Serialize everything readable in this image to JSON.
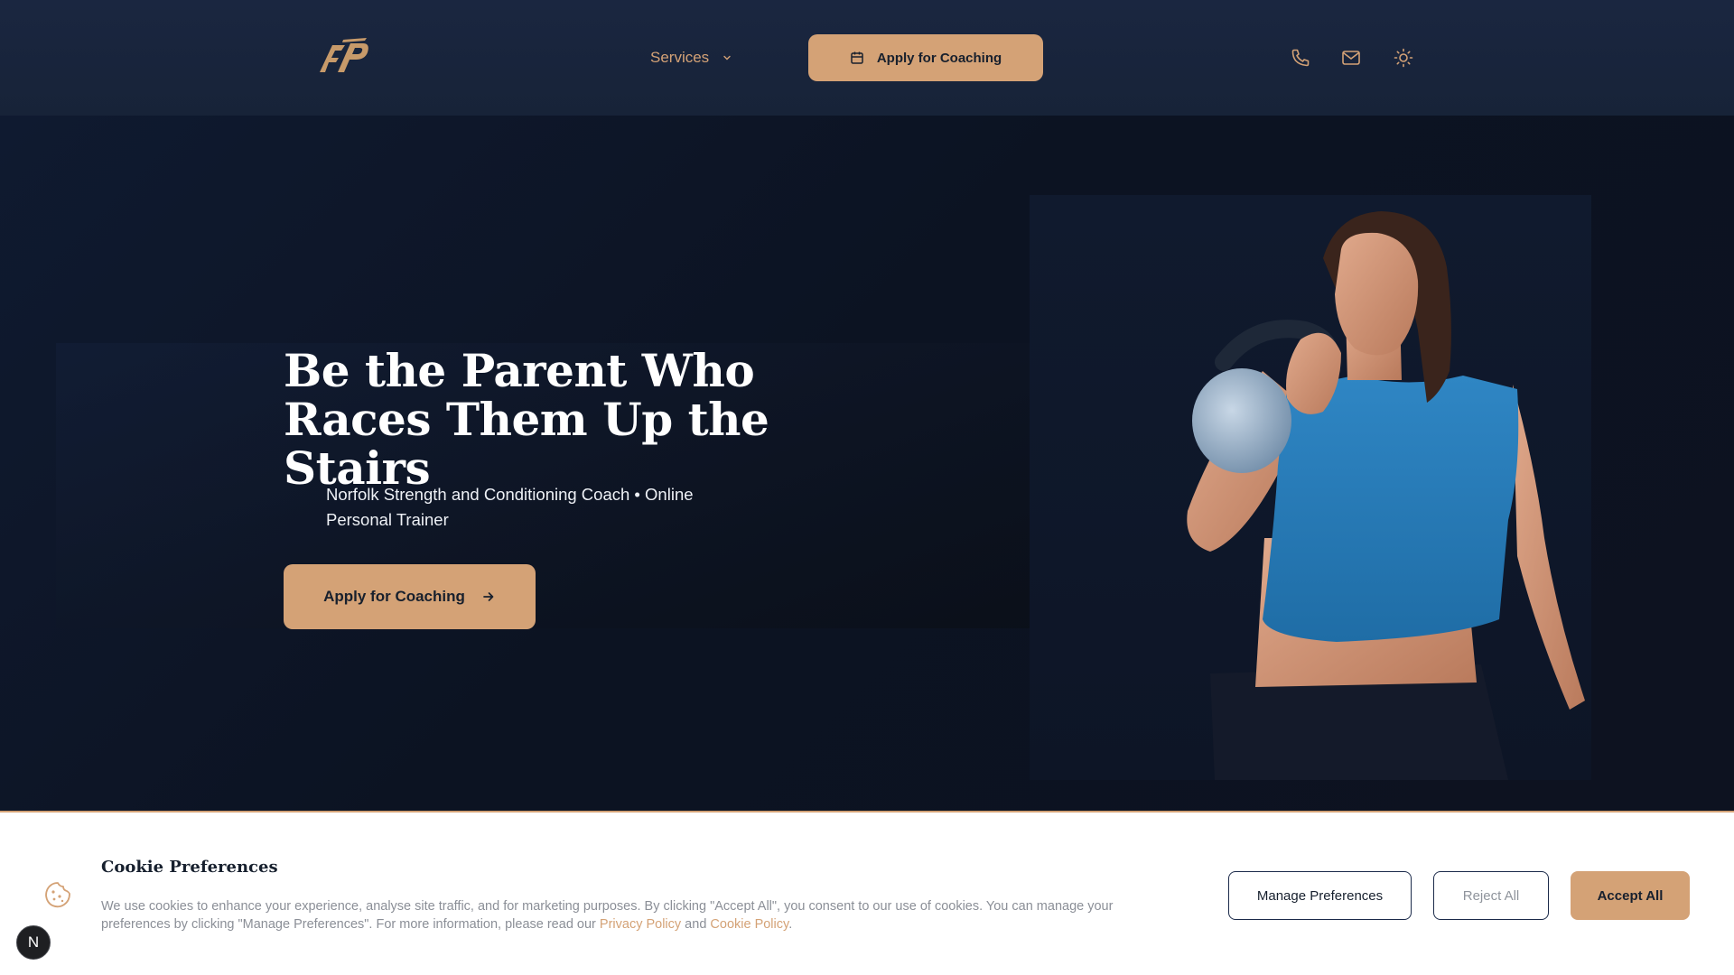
{
  "nav": {
    "services_label": "Services",
    "cta_label": "Apply for Coaching"
  },
  "hero": {
    "title": "Be the Parent Who Races Them Up the Stairs",
    "subtitle": "Norfolk Strength and Conditioning Coach • Online Personal Trainer",
    "cta_label": "Apply for Coaching"
  },
  "cookie": {
    "title": "Cookie Preferences",
    "text_prefix": "We use cookies to enhance your experience, analyse site traffic, and for marketing purposes. By clicking \"Accept All\", you consent to our use of cookies. You can manage your preferences by clicking \"Manage Preferences\". For more information, please read our ",
    "privacy_link": "Privacy Policy",
    "text_and": " and ",
    "cookie_link": "Cookie Policy",
    "text_suffix": ".",
    "manage_label": "Manage Preferences",
    "reject_label": "Reject All",
    "accept_label": "Accept All"
  },
  "badge": {
    "label": "N"
  },
  "colors": {
    "accent": "#d4a276",
    "nav_bg": "#1a2640",
    "hero_bg": "#0d1526",
    "banner_bg": "#ffffff"
  },
  "icons": [
    "logo-fp",
    "chevron-down-icon",
    "calendar-icon",
    "arrow-right-icon",
    "phone-icon",
    "mail-icon",
    "sun-icon",
    "cookie-icon"
  ]
}
